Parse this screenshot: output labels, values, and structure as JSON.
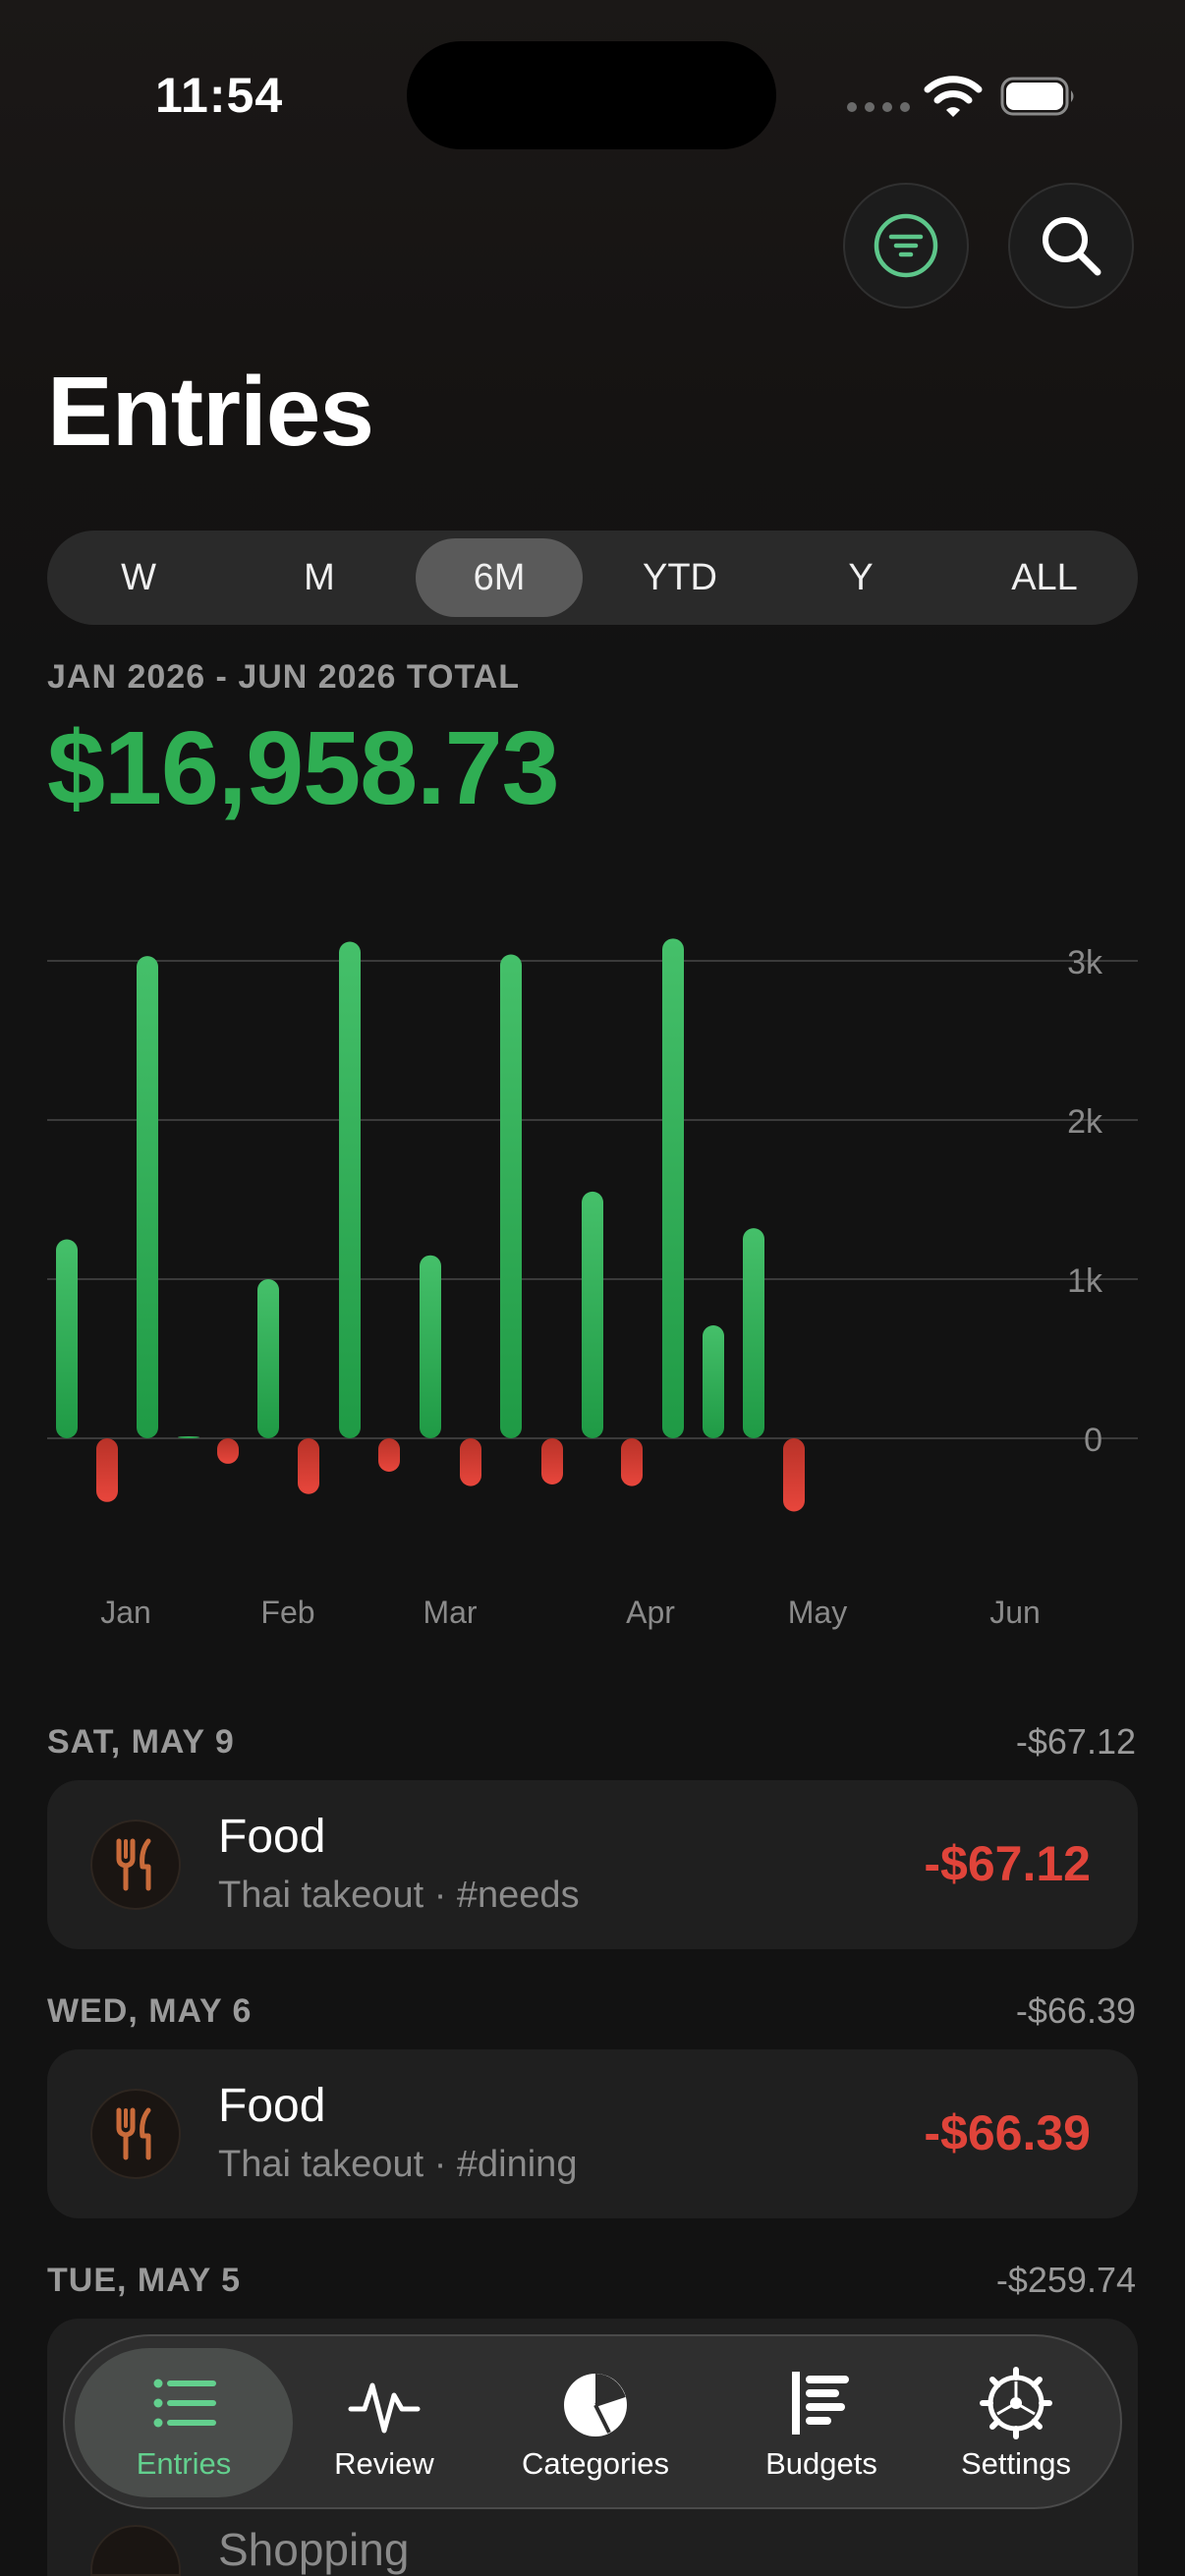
{
  "status": {
    "time": "11:54"
  },
  "header": {
    "title": "Entries"
  },
  "range_tabs": [
    {
      "label": "W",
      "active": false
    },
    {
      "label": "M",
      "active": false
    },
    {
      "label": "6M",
      "active": true
    },
    {
      "label": "YTD",
      "active": false
    },
    {
      "label": "Y",
      "active": false
    },
    {
      "label": "ALL",
      "active": false
    }
  ],
  "summary": {
    "period_label": "JAN 2026 - JUN 2026 TOTAL",
    "total": "$16,958.73"
  },
  "chart_data": {
    "type": "bar",
    "x_ticks": [
      "Jan",
      "Feb",
      "Mar",
      "Apr",
      "May",
      "Jun"
    ],
    "y_ticks": [
      "3k",
      "2k",
      "1k",
      "0"
    ],
    "ylim": [
      -500,
      3200
    ],
    "series": [
      {
        "color": "#34b35a",
        "values": [
          1250,
          3030,
          10,
          1000,
          3120,
          1150,
          3040,
          1550,
          3140,
          710,
          1320
        ]
      },
      {
        "color": "#e0443a",
        "values": [
          -400,
          -160,
          -350,
          -210,
          -300,
          -290,
          -300,
          -460
        ]
      }
    ],
    "grid": true
  },
  "days": [
    {
      "date": "SAT, MAY 9",
      "total": "-$67.12",
      "entries": [
        {
          "category": "Food",
          "note": "Thai takeout · #needs",
          "amount": "-$67.12",
          "icon": "fork-knife-icon"
        }
      ]
    },
    {
      "date": "WED, MAY 6",
      "total": "-$66.39",
      "entries": [
        {
          "category": "Food",
          "note": "Thai takeout · #dining",
          "amount": "-$66.39",
          "icon": "fork-knife-icon"
        }
      ]
    },
    {
      "date": "TUE, MAY 5",
      "total": "-$259.74",
      "entries": [
        {
          "category": "Shopping",
          "icon": "shopping-bag-icon"
        }
      ]
    }
  ],
  "tabbar": [
    {
      "label": "Entries",
      "icon": "list-icon",
      "active": true
    },
    {
      "label": "Review",
      "icon": "pulse-icon",
      "active": false
    },
    {
      "label": "Categories",
      "icon": "pie-chart-icon",
      "active": false
    },
    {
      "label": "Budgets",
      "icon": "bars-icon",
      "active": false
    },
    {
      "label": "Settings",
      "icon": "gear-icon",
      "active": false
    }
  ]
}
